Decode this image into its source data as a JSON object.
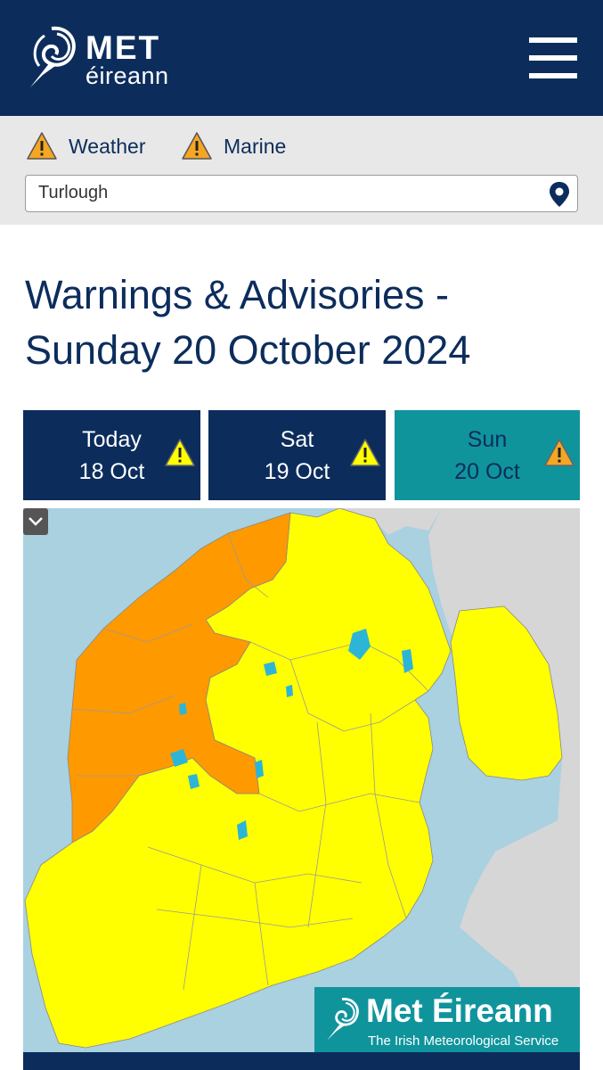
{
  "header": {
    "logo_line1": "MET",
    "logo_line2": "éireann"
  },
  "alerts": {
    "weather_label": "Weather",
    "marine_label": "Marine"
  },
  "location": {
    "value": "Turlough"
  },
  "page": {
    "title": "Warnings & Advisories - Sunday 20 October 2024"
  },
  "day_tabs": [
    {
      "day": "Today",
      "date": "18 Oct",
      "warning_level": "yellow",
      "selected": false
    },
    {
      "day": "Sat",
      "date": "19 Oct",
      "warning_level": "yellow",
      "selected": false
    },
    {
      "day": "Sun",
      "date": "20 Oct",
      "warning_level": "orange",
      "selected": true
    }
  ],
  "map": {
    "watermark_title": "Met Éireann",
    "watermark_subtitle": "The Irish Meteorological Service",
    "regions": [
      {
        "region": "west coast",
        "warning": "orange"
      },
      {
        "region": "north-west coast",
        "warning": "orange"
      },
      {
        "region": "west inland",
        "warning": "orange"
      },
      {
        "region": "rest of country",
        "warning": "yellow"
      }
    ]
  },
  "colors": {
    "navy": "#0c2d5c",
    "teal": "#10949c",
    "yellow_warning": "#ffff00",
    "orange_warning": "#ff9900",
    "sea": "#a9d1e0",
    "neighbour_land": "#d6d6d6",
    "lake": "#2cb5d6"
  },
  "icons": {
    "menu": "hamburger-menu-icon",
    "alert": "warning-triangle-icon",
    "location": "location-pin-icon",
    "map_control": "chevron-down-icon"
  }
}
